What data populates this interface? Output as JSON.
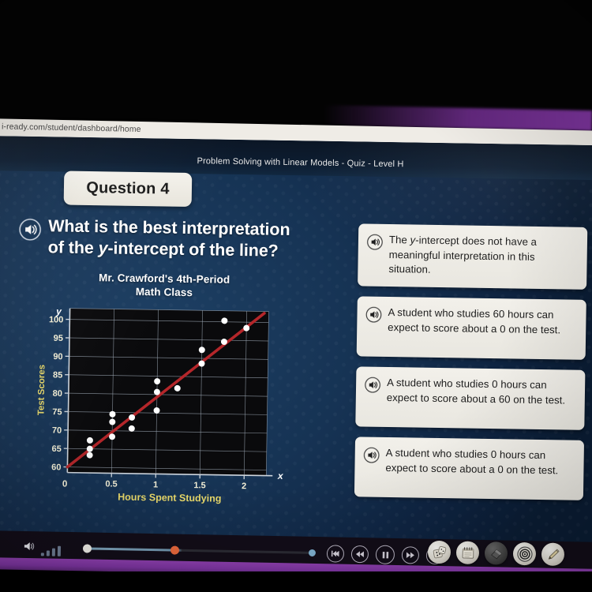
{
  "browser": {
    "url": "i-ready.com/student/dashboard/home"
  },
  "header": {
    "lesson_title": "Problem Solving with Linear Models - Quiz - Level H",
    "question_badge": "Question 4"
  },
  "question": {
    "speaker_icon": "speaker-icon",
    "line1": "What is the best interpretation",
    "line2_pre": "of the ",
    "line2_italic": "y",
    "line2_post": "-intercept of the line?"
  },
  "choices": [
    {
      "id": "choice-a",
      "speaker_icon": "speaker-icon",
      "text_pre": "The ",
      "text_italic": "y",
      "text_post": "-intercept does not have a meaningful interpretation in this situation."
    },
    {
      "id": "choice-b",
      "speaker_icon": "speaker-icon",
      "text_pre": "",
      "text_italic": "",
      "text_post": "A student who studies 60 hours can expect to score about a 0 on the test."
    },
    {
      "id": "choice-c",
      "speaker_icon": "speaker-icon",
      "text_pre": "",
      "text_italic": "",
      "text_post": "A student who studies 0 hours can expect to score about a 60 on the test."
    },
    {
      "id": "choice-d",
      "speaker_icon": "speaker-icon",
      "text_pre": "",
      "text_italic": "",
      "text_post": "A student who studies 0 hours can expect to score about a 0 on the test."
    }
  ],
  "chart_data": {
    "type": "scatter",
    "title": "Mr. Crawford's 4th-Period Math Class",
    "title_line1": "Mr. Crawford's 4th-Period",
    "title_line2": "Math Class",
    "xlabel": "Hours Spent Studying",
    "ylabel": "Test Scores",
    "x_axis_symbol": "x",
    "y_axis_symbol": "y",
    "origin_label": "0",
    "xlim": [
      0,
      2.25
    ],
    "ylim": [
      58.5,
      103
    ],
    "xticks": [
      0,
      0.5,
      1,
      1.5,
      2
    ],
    "xtick_labels": [
      "0",
      "0.5",
      "1",
      "1.5",
      "2"
    ],
    "yticks": [
      60,
      65,
      70,
      75,
      80,
      85,
      90,
      95,
      100
    ],
    "ytick_labels": [
      "60",
      "65",
      "70",
      "75",
      "80",
      "85",
      "90",
      "95",
      "100"
    ],
    "grid": true,
    "point_color": "#ffffff",
    "line_color": "#b4262a",
    "plot_bg": "#0a0a0c",
    "axis_text_color": "#f5f1d8",
    "points": [
      {
        "x": 0.25,
        "y": 67.3
      },
      {
        "x": 0.25,
        "y": 65.0
      },
      {
        "x": 0.25,
        "y": 63.3
      },
      {
        "x": 0.5,
        "y": 74.5
      },
      {
        "x": 0.5,
        "y": 72.4
      },
      {
        "x": 0.5,
        "y": 68.4
      },
      {
        "x": 0.72,
        "y": 73.7
      },
      {
        "x": 0.72,
        "y": 70.7
      },
      {
        "x": 1.0,
        "y": 83.6
      },
      {
        "x": 1.0,
        "y": 80.7
      },
      {
        "x": 1.0,
        "y": 75.7
      },
      {
        "x": 1.23,
        "y": 81.8
      },
      {
        "x": 1.5,
        "y": 92.3
      },
      {
        "x": 1.5,
        "y": 88.6
      },
      {
        "x": 1.75,
        "y": 100.3
      },
      {
        "x": 1.75,
        "y": 94.6
      },
      {
        "x": 2.0,
        "y": 98.4
      }
    ],
    "trend_line": {
      "description": "line of best fit",
      "x_start": 0,
      "y_start": 60,
      "x_end": 2.2,
      "y_end": 102.5,
      "y_intercept": 60,
      "slope": 19.3
    }
  },
  "player": {
    "transport": [
      {
        "name": "skip-to-start-button",
        "glyph": "skip-back"
      },
      {
        "name": "rewind-button",
        "glyph": "rewind"
      },
      {
        "name": "pause-button",
        "glyph": "pause"
      },
      {
        "name": "fast-forward-button",
        "glyph": "fast-forward"
      },
      {
        "name": "skip-to-end-button",
        "glyph": "skip-forward"
      }
    ],
    "tools": [
      {
        "name": "dice-tool",
        "label": "dice"
      },
      {
        "name": "notepad-tool",
        "label": "notepad"
      },
      {
        "name": "eraser-tool",
        "label": "eraser"
      },
      {
        "name": "target-tool",
        "label": "target"
      },
      {
        "name": "pencil-tool",
        "label": "pencil"
      }
    ],
    "volume_icon": "volume-icon",
    "volume_bars": 4
  }
}
